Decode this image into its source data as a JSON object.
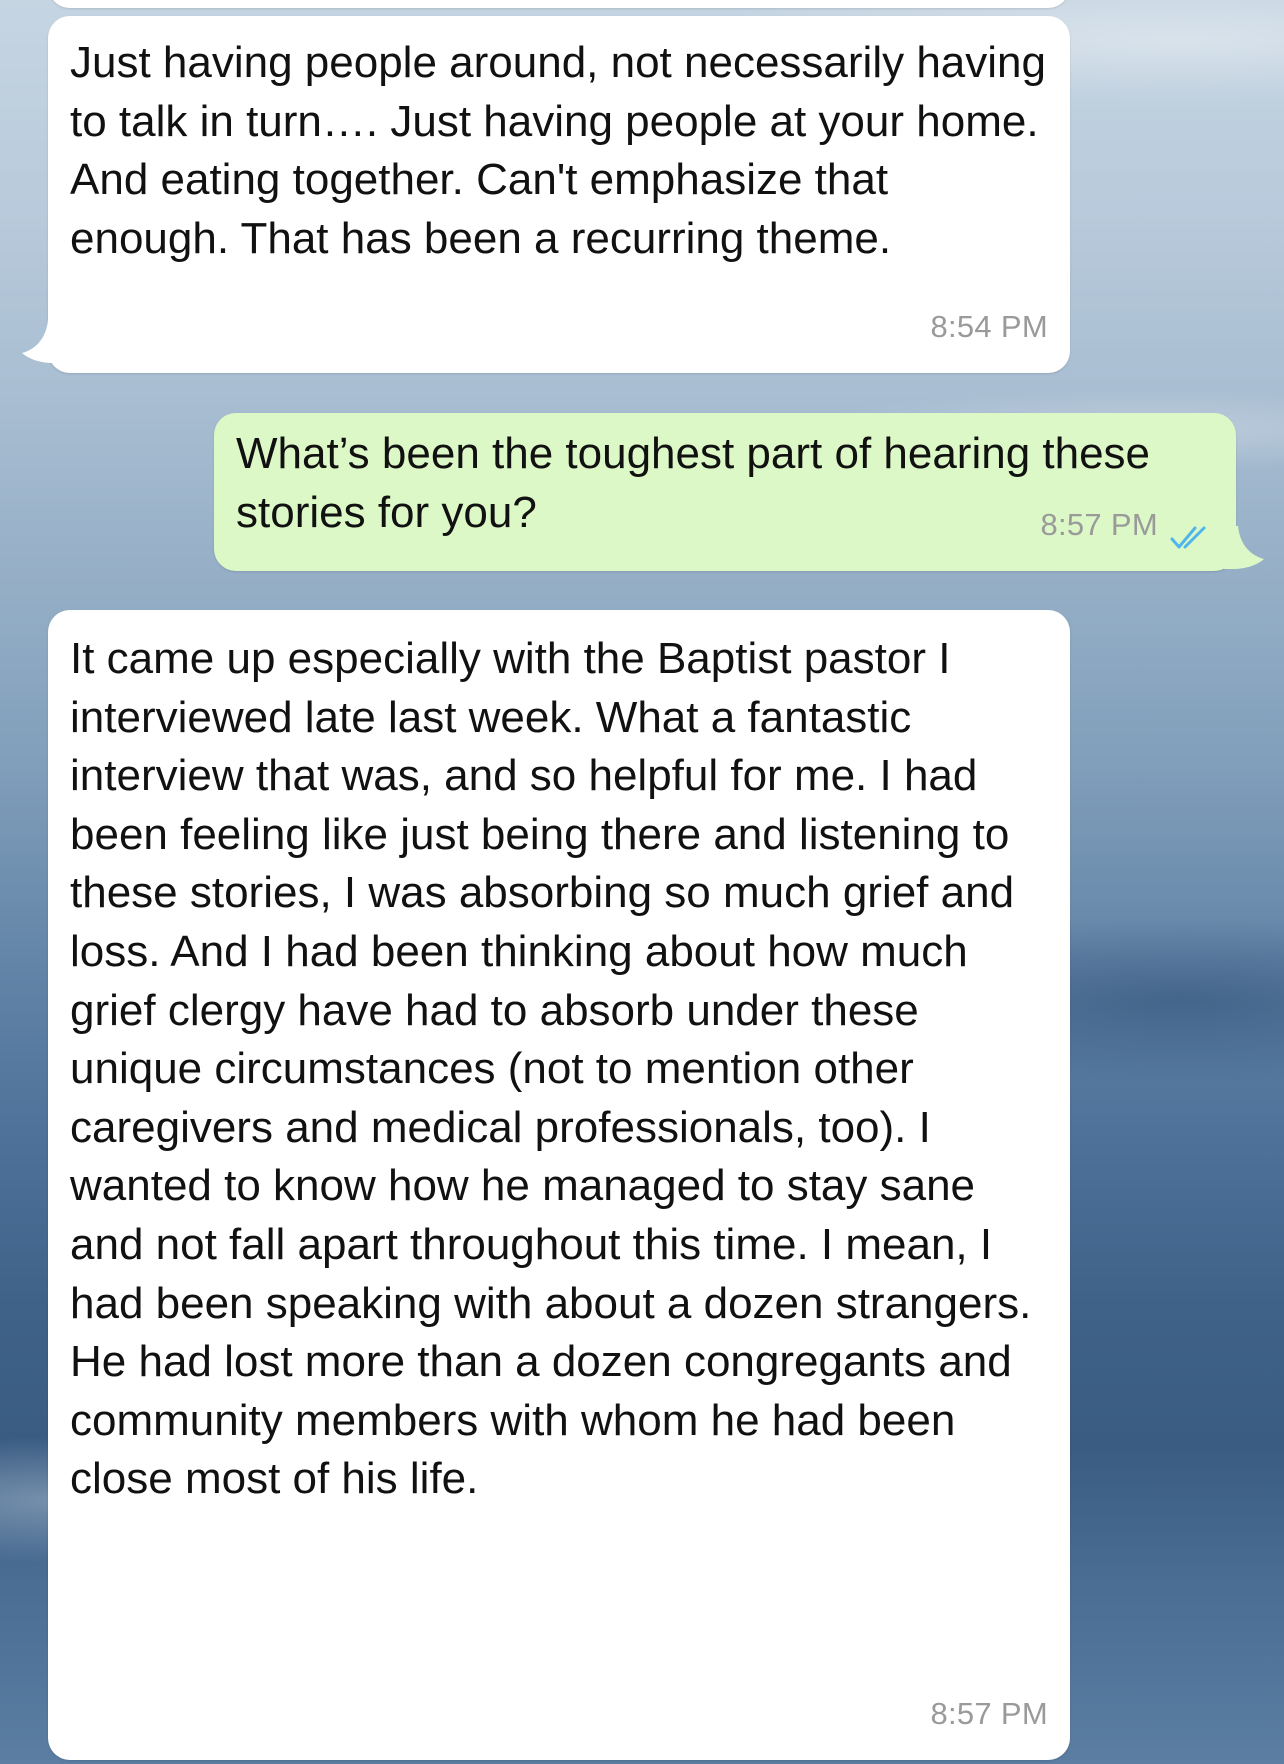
{
  "messages": [
    {
      "direction": "incoming",
      "text": "Just having people around, not necessarily having to talk in turn…. Just having people at your home. And eating together. Can't emphasize that enough. That has been a recurring theme.",
      "time": "8:54 PM"
    },
    {
      "direction": "outgoing",
      "text": "What’s been the toughest part of hearing these stories for you?",
      "time": "8:57 PM",
      "status_icon": "double-check-read-icon"
    },
    {
      "direction": "incoming",
      "text": "It came up especially with the Baptist pastor I interviewed late last week. What a fantastic interview that was, and so helpful for me. I had been feeling like just being there and listening to these stories, I was absorbing so much grief and loss. And I had been thinking about how much grief clergy have had to absorb under these unique circumstances (not to mention other caregivers and medical professionals, too). I wanted to know how he managed to stay sane and not fall apart throughout this time. I mean, I had been speaking with about a dozen strangers. He had lost more than a dozen congregants and community members with whom he had been close most of his life.",
      "time": "8:57 PM"
    }
  ],
  "colors": {
    "incoming_bubble": "#ffffff",
    "outgoing_bubble": "#dcf8c6",
    "timestamp": "#9a9a9a",
    "read_ticks": "#4fb6ec"
  }
}
